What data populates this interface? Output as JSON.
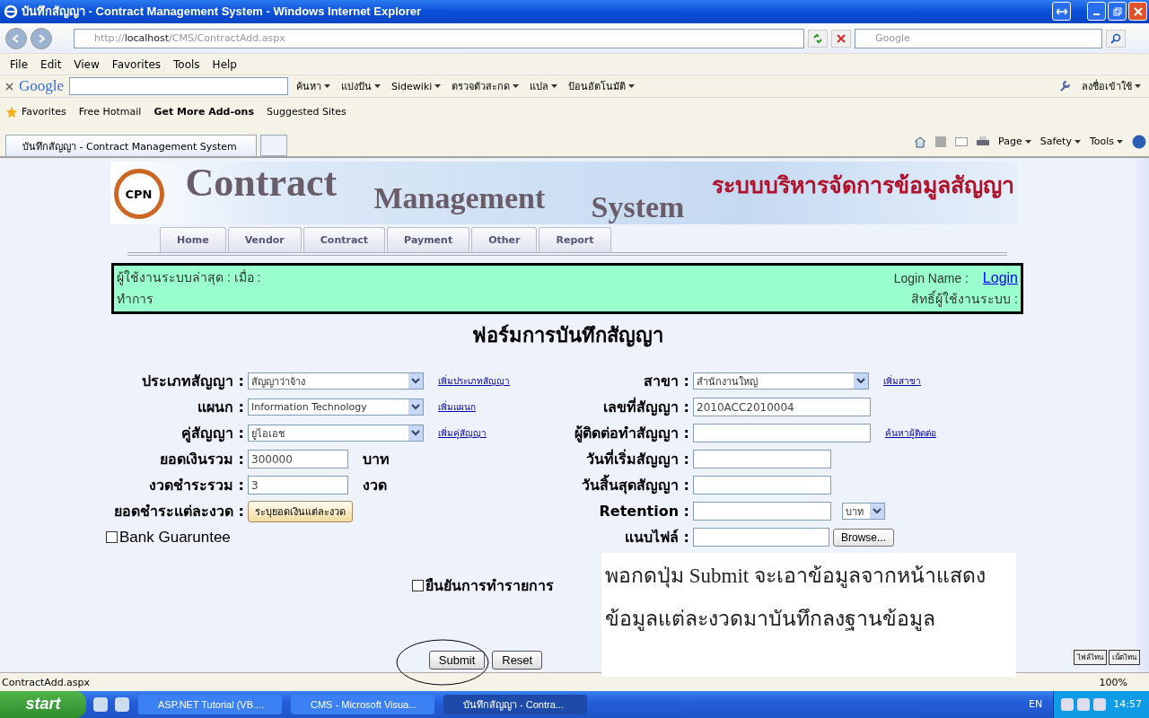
{
  "window": {
    "title": "บันทึกสัญญา - Contract Management System - Windows Internet Explorer"
  },
  "address_bar": {
    "url_prefix": "http://",
    "url_host": "localhost",
    "url_path": "/CMS/ContractAdd.aspx",
    "search_placeholder": "Google"
  },
  "menu": [
    "File",
    "Edit",
    "View",
    "Favorites",
    "Tools",
    "Help"
  ],
  "google_toolbar": {
    "logo": "Google",
    "items": [
      "ค้นหา",
      "แบ่งปัน",
      "Sidewiki",
      "ตรวจตัวสะกด",
      "แปล",
      "ป้อนอัตโนมัติ"
    ],
    "sign_in": "ลงชื่อเข้าใช้"
  },
  "favorites_bar": {
    "label": "Favorites",
    "items": [
      {
        "label": "Free Hotmail",
        "bold": false
      },
      {
        "label": "Get More Add-ons",
        "bold": true
      },
      {
        "label": "Suggested Sites",
        "bold": false
      }
    ]
  },
  "browser_tab": {
    "title": "บันทึกสัญญา - Contract Management System"
  },
  "command_bar": [
    "Page",
    "Safety",
    "Tools"
  ],
  "banner": {
    "logo": "CPN",
    "word_1": "Contract",
    "word_2": "Management",
    "word_3": "System",
    "thai_title": "ระบบบริหารจัดการข้อมูลสัญญา"
  },
  "nav_tabs": [
    "Home",
    "Vendor",
    "Contract",
    "Payment",
    "Other",
    "Report"
  ],
  "user_info": {
    "last_user": "ผู้ใช้งานระบบล่าสุด :   เมื่อ :",
    "action": "ทำการ",
    "login_name_label": "Login Name :",
    "login_link": "Login",
    "rights": "สิทธิ์ผู้ใช้งานระบบ :"
  },
  "form": {
    "title": "ฟอร์มการบันทึกสัญญา",
    "left_rows": [
      {
        "kind": "select",
        "label": "ประเภทสัญญา :",
        "value": "สัญญาว่าจ้าง",
        "link": "เพิ่มประเภทสัญญา"
      },
      {
        "kind": "select",
        "label": "แผนก :",
        "value": "Information Technology",
        "link": "เพิ่มแผนก"
      },
      {
        "kind": "select",
        "label": "คู่สัญญา :",
        "value": "ยูไอเอช",
        "link": "เพิ่มคู่สัญญา"
      },
      {
        "kind": "text",
        "label": "ยอดเงินรวม :",
        "value": "300000",
        "unit": "บาท"
      },
      {
        "kind": "text",
        "label": "งวดชำระรวม :",
        "value": "3",
        "unit": "งวด"
      },
      {
        "kind": "button",
        "label": "ยอดชำระแต่ละงวด :",
        "value": "ระบุยอดเงินแต่ละงวด"
      }
    ],
    "right_rows": [
      {
        "kind": "select",
        "label": "สาขา :",
        "value": "สำนักงานใหญ่",
        "link": "เพิ่มสาขา"
      },
      {
        "kind": "wide",
        "label": "เลขที่สัญญา :",
        "value": "2010ACC2010004"
      },
      {
        "kind": "wide",
        "label": "ผู้ติดต่อทำสัญญา :",
        "value": "",
        "link": "ค้นหาผู้ติดต่อ"
      },
      {
        "kind": "text",
        "label": "วันที่เริ่มสัญญา :",
        "value": ""
      },
      {
        "kind": "text",
        "label": "วันสิ้นสุดสัญญา :",
        "value": ""
      },
      {
        "kind": "unit_select",
        "label": "Retention :",
        "value": "",
        "unit": "บาท"
      },
      {
        "kind": "file",
        "label": "แนบไฟล์ :",
        "value": "",
        "button": "Browse..."
      }
    ],
    "bank_guarantee": {
      "label": "Bank Guaruntee",
      "checked": false
    },
    "confirm": {
      "label": "ยืนยันการทำรายการ",
      "checked": false
    },
    "buttons": [
      "Submit",
      "Reset"
    ]
  },
  "annotation": {
    "text": "พอกดปุ่ม Submit จะเอาข้อมูลจากหน้าแสดงข้อมูลแต่ละงวดมาบันทึกลงฐานข้อมูล"
  },
  "corner_widget": [
    "ไฟล์ไทน",
    "เน็ตไทน"
  ],
  "status_bar": {
    "text": "ContractAdd.aspx",
    "zoom": "100%"
  },
  "taskbar": {
    "start": "start",
    "tasks": [
      {
        "label": "ASP.NET Tutorial (VB....",
        "selected": false
      },
      {
        "label": "CMS - Microsoft Visua...",
        "selected": false
      },
      {
        "label": "บันทึกสัญญา - Contra...",
        "selected": true
      }
    ],
    "language": "EN",
    "clock": "14:57"
  }
}
